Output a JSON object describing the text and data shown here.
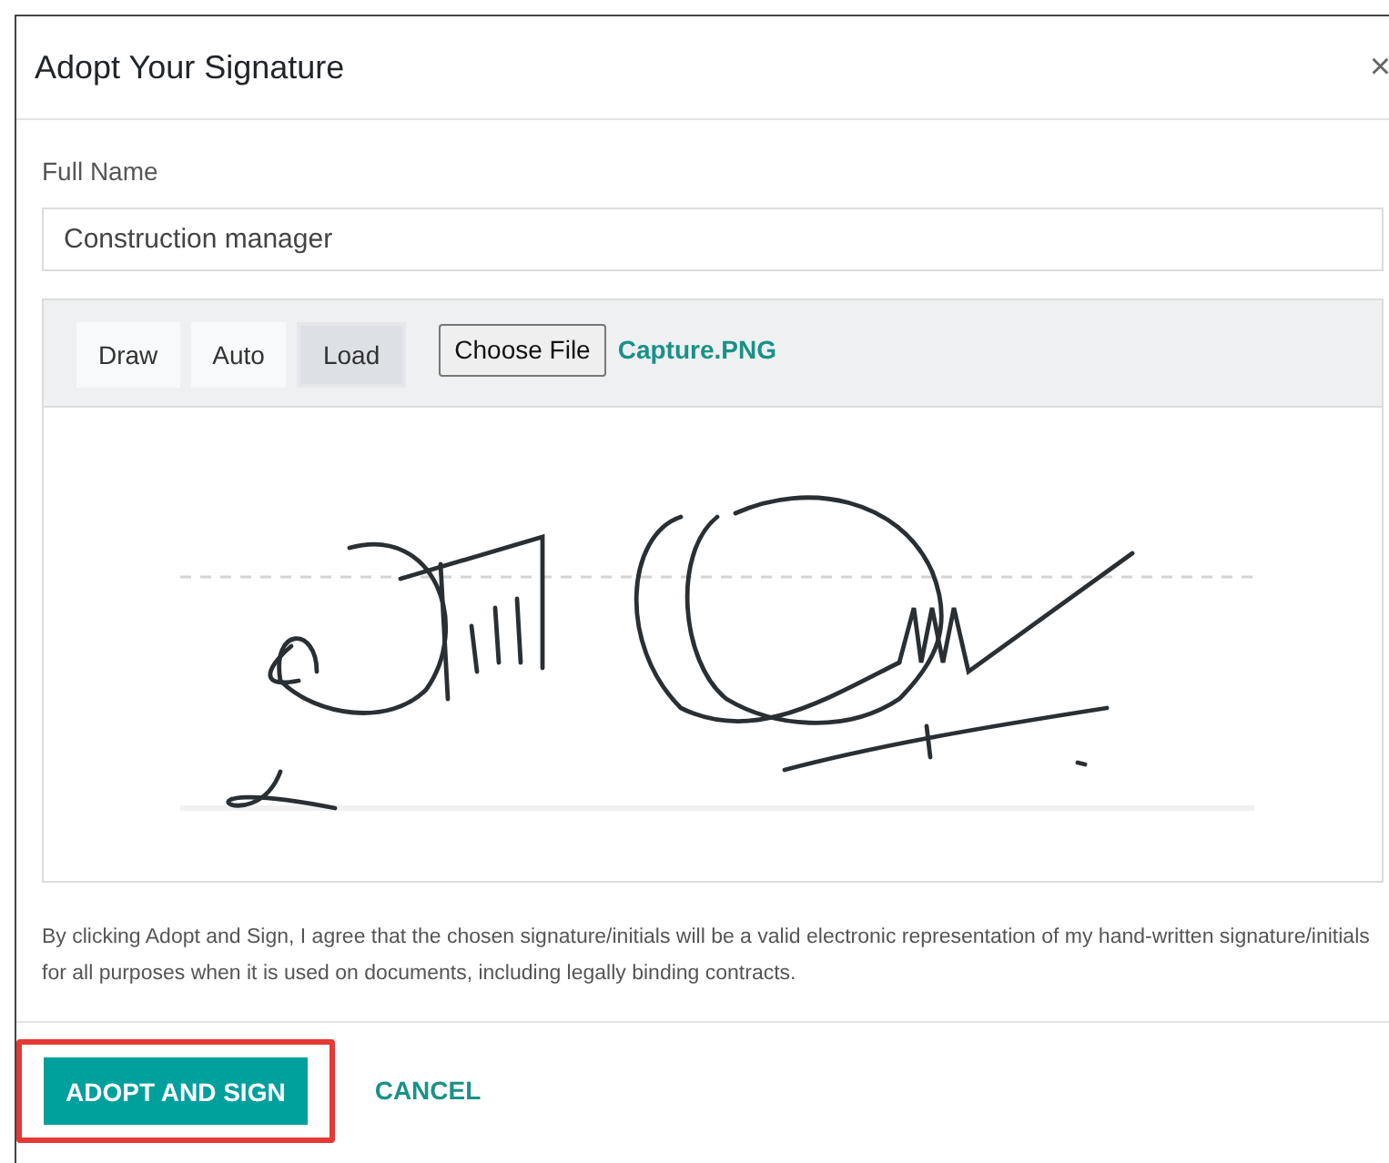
{
  "dialog": {
    "title": "Adopt Your Signature",
    "close": "×"
  },
  "full_name": {
    "label": "Full Name",
    "value": "Construction manager"
  },
  "signature_pad": {
    "tabs": [
      {
        "label": "Draw",
        "selected": false
      },
      {
        "label": "Auto",
        "selected": false
      },
      {
        "label": "Load",
        "selected": true
      }
    ],
    "choose_file": "Choose File",
    "file_name": "Capture.PNG"
  },
  "consent": "By clicking Adopt and Sign, I agree that the chosen signature/initials will be a valid electronic representation of my hand-written signature/initials for all purposes when it is used on documents, including legally binding contracts.",
  "buttons": [
    {
      "label": "ADOPT AND SIGN",
      "kind": "primary",
      "highlighted": true
    },
    {
      "label": "CANCEL",
      "kind": "link",
      "highlighted": false
    }
  ]
}
